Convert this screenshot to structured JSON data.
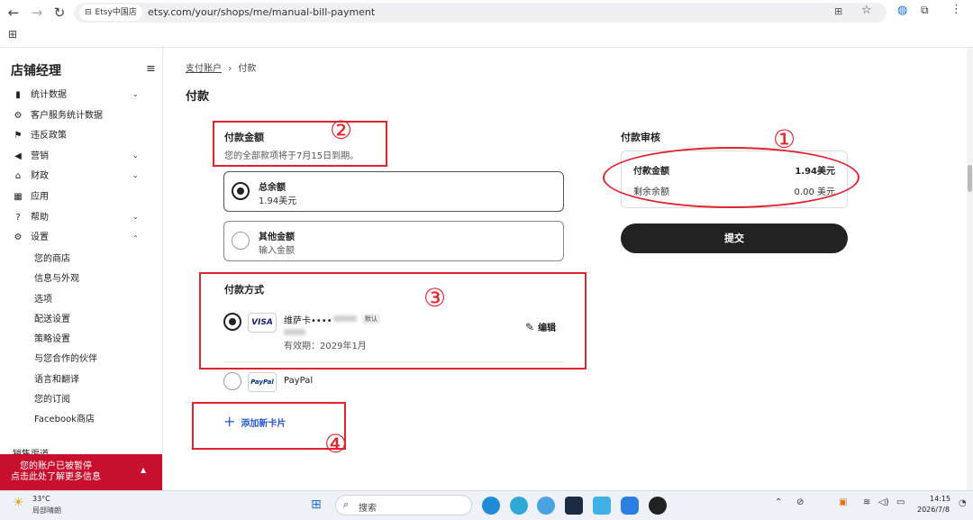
{
  "browser": {
    "site_chip": "Etsy中国店",
    "url": "etsy.com/your/shops/me/manual-bill-payment"
  },
  "sidebar": {
    "title": "店铺经理",
    "items": [
      {
        "label": "统计数据",
        "icon": "bar-chart-icon",
        "chev": "⌄"
      },
      {
        "label": "客户服务统计数据",
        "icon": "gear-icon",
        "chev": ""
      },
      {
        "label": "违反政策",
        "icon": "flag-icon",
        "chev": ""
      },
      {
        "label": "营销",
        "icon": "megaphone-icon",
        "chev": "⌄"
      },
      {
        "label": "财政",
        "icon": "bank-icon",
        "chev": "⌄"
      },
      {
        "label": "应用",
        "icon": "grid-icon",
        "chev": ""
      },
      {
        "label": "帮助",
        "icon": "help-icon",
        "chev": "⌄"
      },
      {
        "label": "设置",
        "icon": "settings-icon",
        "chev": "⌃"
      }
    ],
    "sub_items": [
      "您的商店",
      "信息与外观",
      "选项",
      "配送设置",
      "策略设置",
      "与您合作的伙伴",
      "语言和翻译",
      "您的订阅",
      "Facebook商店"
    ],
    "cut_off_label": "销售渠道",
    "alert_line1": "您的账户已被暂停",
    "alert_line2": "点击此处了解更多信息"
  },
  "breadcrumb": {
    "parent": "支付账户",
    "sep": "›",
    "current": "付款"
  },
  "page_title": "付款",
  "amount_section": {
    "title": "付款金额",
    "subtitle": "您的全部款项将于7月15日到期。",
    "options": [
      {
        "title": "总余额",
        "value": "1.94美元",
        "selected": true
      },
      {
        "title": "其他金额",
        "value": "输入金额",
        "selected": false
      }
    ]
  },
  "method_section": {
    "title": "付款方式",
    "card": {
      "brand": "VISA",
      "name": "维萨卡••••",
      "default_badge": "默认",
      "expiry": "有效期：2029年1月",
      "edit": "编辑"
    },
    "paypal": {
      "brand": "PayPal",
      "label": "PayPal"
    },
    "add_card": "添加新卡片"
  },
  "review": {
    "title": "付款审核",
    "rows": [
      {
        "label": "付款金额",
        "value": "1.94美元"
      },
      {
        "label": "剩余余额",
        "value": "0.00 美元"
      }
    ],
    "submit": "提交"
  },
  "annotations": [
    "①",
    "②",
    "③",
    "④"
  ],
  "taskbar": {
    "temp": "33°C",
    "weather": "局部晴朗",
    "search": "搜索",
    "time": "14:15",
    "date": "2026/7/8"
  },
  "colors": {
    "accent_red": "#e0232e",
    "alert_bg": "#c8102e",
    "submit_bg": "#222222"
  }
}
